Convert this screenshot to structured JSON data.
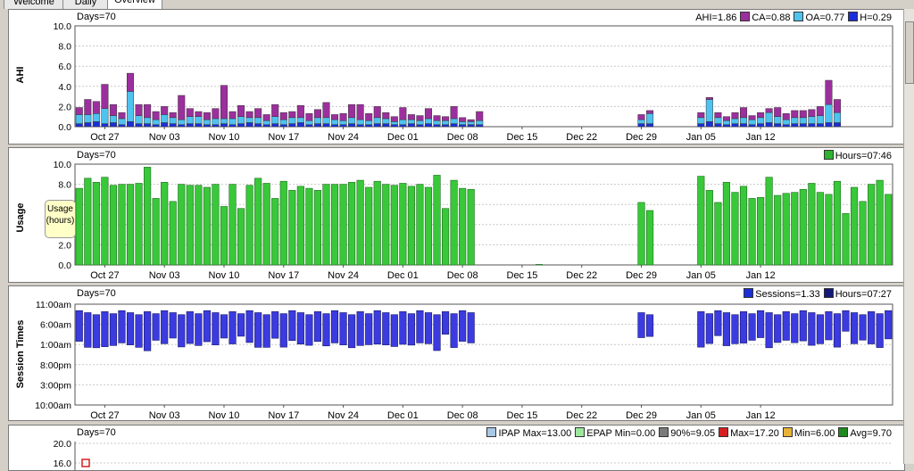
{
  "tabs": [
    {
      "label": "Welcome",
      "active": false
    },
    {
      "label": "Daily",
      "active": false
    },
    {
      "label": "Overview",
      "active": true
    }
  ],
  "date_labels": [
    "Oct 27",
    "Nov 03",
    "Nov 10",
    "Nov 17",
    "Nov 24",
    "Dec 01",
    "Dec 08",
    "Dec 15",
    "Dec 22",
    "Dec 29",
    "Jan 05",
    "Jan 12"
  ],
  "chart_data": [
    {
      "type": "bar",
      "name_label": "AHI",
      "days_label": "Days=70",
      "ylim": [
        0,
        10
      ],
      "yticks": [
        "0.0",
        "2.0",
        "4.0",
        "6.0",
        "8.0",
        "10.0"
      ],
      "stacked": true,
      "legend": [
        {
          "text": "AHI=1.86",
          "color": null
        },
        {
          "text": "CA=0.88",
          "color": "#9c2f9e"
        },
        {
          "text": "OA=0.77",
          "color": "#4fc3f0"
        },
        {
          "text": "H=0.29",
          "color": "#1c2fd6"
        }
      ],
      "series": [
        {
          "name": "H",
          "color": "#1c2fd6",
          "values": [
            0.3,
            0.4,
            0.5,
            0.3,
            0.4,
            0.2,
            0.5,
            0.3,
            0.3,
            0.2,
            0.4,
            0.3,
            0.2,
            0.3,
            0.3,
            0.2,
            0.2,
            0.3,
            0.2,
            0.3,
            0.4,
            0.3,
            0.2,
            0.3,
            0.2,
            0.3,
            0.4,
            0.2,
            0.3,
            0.3,
            0.2,
            0.2,
            0.3,
            0.2,
            0.2,
            0.3,
            0.3,
            0.2,
            0.2,
            0.3,
            0.2,
            0.3,
            0.2,
            0.2,
            0.3,
            0.2,
            0.2,
            0.2,
            0,
            0,
            0,
            0,
            0,
            0,
            0,
            0,
            0,
            0,
            0,
            0,
            0,
            0,
            0,
            0,
            0,
            0,
            0.3,
            0.3,
            0,
            0,
            0,
            0,
            0,
            0.3,
            0.5,
            0.3,
            0.2,
            0.3,
            0.3,
            0.2,
            0.3,
            0.4,
            0.3,
            0.2,
            0.3,
            0.3,
            0.3,
            0.3,
            0.4,
            0.4
          ]
        },
        {
          "name": "OA",
          "color": "#4fc3f0",
          "values": [
            0.9,
            0.8,
            0.8,
            1.5,
            0.7,
            0.6,
            3.0,
            0.8,
            0.6,
            0.5,
            0.8,
            0.6,
            0.5,
            0.7,
            0.7,
            0.5,
            0.6,
            0.5,
            0.6,
            0.7,
            0.5,
            0.6,
            0.4,
            0.7,
            0.5,
            0.6,
            0.5,
            0.4,
            0.6,
            0.6,
            0.5,
            0.4,
            0.6,
            0.5,
            0.4,
            0.6,
            0.5,
            0.3,
            0.5,
            0.4,
            0.4,
            0.5,
            0.4,
            0.4,
            0.5,
            0.3,
            0.3,
            0.4,
            0,
            0,
            0,
            0,
            0,
            0,
            0,
            0,
            0,
            0,
            0,
            0,
            0,
            0,
            0,
            0,
            0,
            0,
            0.4,
            1.0,
            0,
            0,
            0,
            0,
            0,
            0.6,
            2.2,
            0.6,
            0.4,
            0.5,
            0.6,
            0.5,
            0.6,
            1.0,
            0.7,
            0.5,
            0.6,
            0.6,
            0.7,
            0.8,
            1.8,
            1.0
          ]
        },
        {
          "name": "CA",
          "color": "#9c2f9e",
          "values": [
            0.7,
            1.5,
            1.2,
            2.4,
            1.1,
            0.6,
            1.8,
            1.1,
            1.3,
            0.8,
            0.8,
            0.5,
            2.4,
            0.8,
            0.5,
            0.7,
            1.0,
            3.3,
            0.7,
            1.1,
            0.6,
            0.9,
            0.6,
            1.2,
            0.7,
            0.6,
            1.2,
            0.7,
            0.8,
            1.5,
            0.5,
            0.7,
            1.3,
            1.5,
            0.7,
            1.1,
            0.6,
            0.5,
            1.2,
            0.5,
            0.5,
            1.0,
            0.5,
            0.4,
            1.2,
            0.4,
            0.2,
            0.9,
            0,
            0,
            0,
            0,
            0,
            0,
            0,
            0,
            0,
            0,
            0,
            0,
            0,
            0,
            0,
            0,
            0,
            0,
            0.5,
            0.3,
            0,
            0,
            0,
            0,
            0,
            0.5,
            0.2,
            0.5,
            0.4,
            0.6,
            1.0,
            0.4,
            0.5,
            0.4,
            0.9,
            0.6,
            0.7,
            0.7,
            0.7,
            0.9,
            2.4,
            1.3
          ]
        }
      ]
    },
    {
      "type": "bar",
      "name_label": "Usage",
      "days_label": "Days=70",
      "tooltip": [
        "Usage",
        "(hours)"
      ],
      "ylim": [
        0,
        10
      ],
      "yticks": [
        "0.0",
        "2.0",
        "4.0",
        "6.0",
        "8.0",
        "10.0"
      ],
      "legend": [
        {
          "text": "Hours=07:46",
          "color": "#2fb22f"
        }
      ],
      "series": [
        {
          "name": "Hours",
          "color": "#39c839",
          "values": [
            7.6,
            8.6,
            8.2,
            8.7,
            7.9,
            8.0,
            8.0,
            8.1,
            9.7,
            6.6,
            8.2,
            6.3,
            8.0,
            7.9,
            7.9,
            7.7,
            8.0,
            5.8,
            8.0,
            5.6,
            7.9,
            8.6,
            8.1,
            6.6,
            8.3,
            7.4,
            7.8,
            7.6,
            7.4,
            8.0,
            8.0,
            8.0,
            8.2,
            8.4,
            7.7,
            8.3,
            8.0,
            7.9,
            8.1,
            7.8,
            8.0,
            7.7,
            8.9,
            5.6,
            8.4,
            7.6,
            7.5,
            0,
            0,
            0,
            0,
            0,
            0,
            0,
            0.05,
            0,
            0,
            0,
            0,
            0,
            0,
            0,
            0,
            0,
            0,
            0,
            6.2,
            5.4,
            0,
            0,
            0,
            0,
            0,
            8.8,
            7.4,
            6.2,
            8.2,
            7.2,
            7.8,
            6.6,
            6.7,
            8.7,
            6.9,
            7.1,
            7.2,
            7.5,
            8.1,
            7.2,
            7.0,
            8.3,
            5.1,
            7.7,
            6.3,
            8.0,
            8.4,
            7.0
          ]
        }
      ]
    },
    {
      "type": "bar",
      "name_label": "Session Times",
      "days_label": "Days=70",
      "yticks": [
        "10:00am",
        "3:00pm",
        "8:00pm",
        "1:00am",
        "6:00am",
        "11:00am"
      ],
      "legend": [
        {
          "text": "Sessions=1.33",
          "color": "#1c2fd6"
        },
        {
          "text": "Hours=07:27",
          "color": "#131a7a"
        }
      ]
    },
    {
      "type": "line",
      "name_label": "",
      "days_label": "Days=70",
      "yticks": [
        "16.0",
        "20.0"
      ],
      "legend": [
        {
          "text": "IPAP Max=13.00",
          "color": "#a9c8e6"
        },
        {
          "text": "EPAP Min=0.00",
          "color": "#9ee89e"
        },
        {
          "text": "90%=9.05",
          "color": "#7a7a7a"
        },
        {
          "text": "Max=17.20",
          "color": "#d62020"
        },
        {
          "text": "Min=6.00",
          "color": "#e8b23a"
        },
        {
          "text": "Avg=9.70",
          "color": "#1d8a1d"
        }
      ]
    }
  ]
}
